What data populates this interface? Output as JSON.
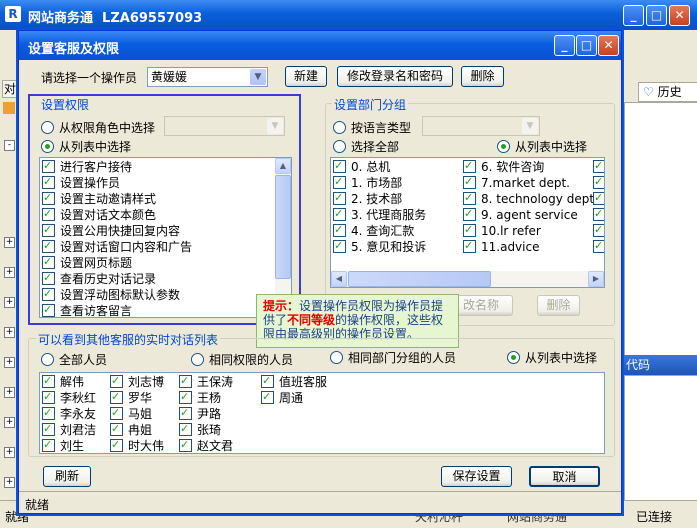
{
  "app": {
    "title": "网站商务通  LZA69557093",
    "icon_glyph": "R",
    "min_glyph": "_",
    "max_glyph": "□",
    "close_glyph": "✕",
    "right_tab_label": "历史",
    "edge_tab_text": "对",
    "right_column_label": "代码",
    "status_left": "就绪",
    "status_mid1": "天村沁杆",
    "status_mid2": "网站商务通",
    "status_right": "已连接"
  },
  "dialog": {
    "title": "设置客服及权限",
    "operator_label": "请选择一个操作员",
    "operator_value": "黄媛媛",
    "new_button": "新建",
    "edit_login_button": "修改登录名和密码",
    "delete_button": "删除",
    "permissions": {
      "group_label": "设置权限",
      "from_role_label": "从权限角色中选择",
      "from_list_label": "从列表中选择",
      "items": [
        "进行客户接待",
        "设置操作员",
        "设置主动邀请样式",
        "设置对话文本颜色",
        "设置公用快捷回复内容",
        "设置对话窗口内容和广告",
        "设置网页标题",
        "查看历史对话记录",
        "设置浮动图标默认参数",
        "查看访客留言"
      ]
    },
    "departments": {
      "group_label": "设置部门分组",
      "by_language_label": "按语言类型",
      "select_all_label": "选择全部",
      "from_list_label": "从列表中选择",
      "col1": [
        "0. 总机",
        "1. 市场部",
        "2. 技术部",
        "3. 代理商服务",
        "4. 查询汇款",
        "5. 意见和投诉"
      ],
      "col2": [
        "6. 软件咨询",
        "7.market dept.",
        "8. technology dept.",
        "9. agent service",
        "10.lr refer",
        "11.advice"
      ],
      "rename_button": "改名称",
      "delete_button": "删除"
    },
    "tooltip": {
      "label": "提示：",
      "text1": "设置操作员权限为操作员提供了",
      "highlight": "不同等级",
      "text2": "的操作权限，这些权限由最高级别的操作员设置。"
    },
    "visible": {
      "group_label": "可以看到其他客服的实时对话列表",
      "all_label": "全部人员",
      "same_perm_label": "相同权限的人员",
      "same_dept_label": "相同部门分组的人员",
      "from_list_label": "从列表中选择",
      "people": [
        [
          "解伟",
          "李秋红",
          "李永友",
          "刘君洁",
          "刘生"
        ],
        [
          "刘志博",
          "罗华",
          "马姐",
          "冉姐",
          "时大伟"
        ],
        [
          "王保涛",
          "王杨",
          "尹路",
          "张琦",
          "赵文君"
        ],
        [
          "值班客服",
          "周通"
        ]
      ]
    },
    "refresh_button": "刷新",
    "save_button": "保存设置",
    "cancel_button": "取消",
    "status_text": "就绪"
  },
  "colors": {
    "accent": "#0a5fd9",
    "check": "#21a121",
    "highlight_border": "#3b3bdb"
  }
}
